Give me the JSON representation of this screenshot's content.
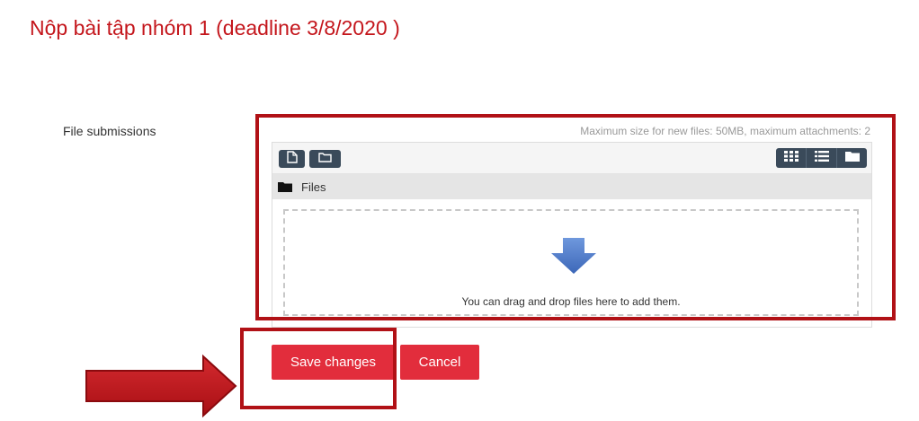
{
  "page": {
    "title": "Nộp bài tập nhóm 1 (deadline 3/8/2020 )"
  },
  "submission": {
    "label": "File submissions",
    "max_info": "Maximum size for new files: 50MB, maximum attachments: 2",
    "toolbar": {
      "left_icons": [
        "add-file-icon",
        "create-folder-icon"
      ],
      "view_icons": [
        "grid-view-icon",
        "list-view-icon",
        "tree-view-icon"
      ]
    },
    "path": {
      "icon": "folder-icon",
      "label": "Files"
    },
    "dropzone": {
      "icon": "down-arrow-icon",
      "text": "You can drag and drop files here to add them."
    }
  },
  "actions": {
    "save_label": "Save changes",
    "cancel_label": "Cancel"
  },
  "colors": {
    "title": "#c4161c",
    "button": "#e22d3c",
    "highlight": "#b11116",
    "toolbar_button": "#3a4a5a",
    "arrow": "#4a7acb"
  }
}
